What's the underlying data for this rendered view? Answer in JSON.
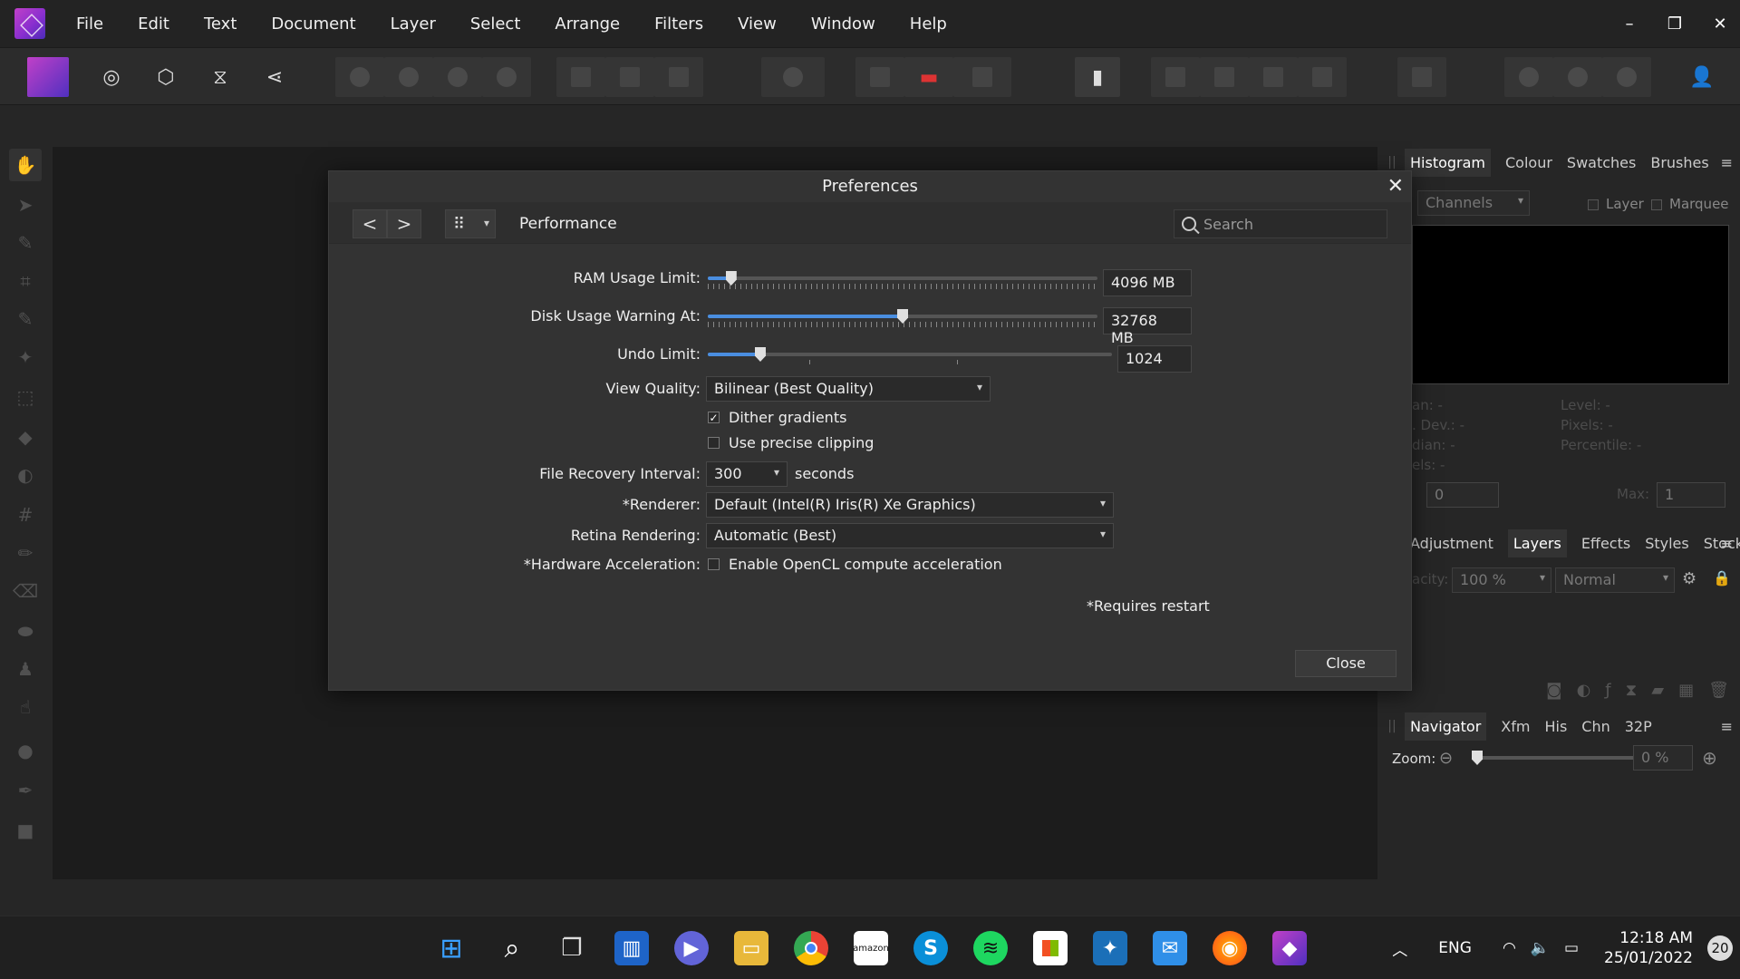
{
  "menubar": {
    "items": [
      "File",
      "Edit",
      "Text",
      "Document",
      "Layer",
      "Select",
      "Arrange",
      "Filters",
      "View",
      "Window",
      "Help"
    ],
    "window_controls": {
      "minimize": "–",
      "restore": "❐",
      "close": "✕"
    }
  },
  "studio": {
    "top_tabs": [
      "Histogram",
      "Colour",
      "Swatches",
      "Brushes"
    ],
    "channels_select": "Channels",
    "layer_check": "Layer",
    "marquee_check": "Marquee",
    "stats_left": [
      "an: -",
      ". Dev.: -",
      "dian: -",
      "els: -"
    ],
    "stats_right": [
      "Level: -",
      "Pixels: -",
      "Percentile: -"
    ],
    "min_value": "0",
    "max_label": "Max:",
    "max_value": "1",
    "mid_tabs": [
      "Adjustment",
      "Layers",
      "Effects",
      "Styles",
      "Stock"
    ],
    "opacity_label": "acity:",
    "opacity_value": "100 %",
    "blend_mode": "Normal",
    "bottom_tabs": [
      "Navigator",
      "Xfm",
      "His",
      "Chn",
      "32P"
    ],
    "zoom_label": "Zoom:",
    "zoom_value": "0 %",
    "panel_menu_glyph": "≡"
  },
  "prefs": {
    "title": "Preferences",
    "section": "Performance",
    "search_placeholder": "Search",
    "nav_back": "<",
    "nav_forward": ">",
    "ram": {
      "label": "RAM Usage Limit:",
      "value": "4096 MB",
      "fraction": 0.06
    },
    "disk": {
      "label": "Disk Usage Warning At:",
      "value": "32768 MB",
      "fraction": 0.5
    },
    "undo": {
      "label": "Undo Limit:",
      "value": "1024",
      "fraction": 0.13
    },
    "view_quality": {
      "label": "View Quality:",
      "value": "Bilinear (Best Quality)"
    },
    "dither": {
      "label": "Dither gradients",
      "checked": true
    },
    "precise_clipping": {
      "label": "Use precise clipping",
      "checked": false
    },
    "recovery": {
      "label": "File Recovery Interval:",
      "value": "300",
      "unit": "seconds"
    },
    "renderer": {
      "label": "*Renderer:",
      "value": "Default (Intel(R) Iris(R) Xe Graphics)"
    },
    "retina": {
      "label": "Retina Rendering:",
      "value": "Automatic (Best)"
    },
    "hw_accel": {
      "label": "*Hardware Acceleration:",
      "option": "Enable OpenCL compute acceleration",
      "checked": false
    },
    "requires_restart": "*Requires restart",
    "close_button": "Close"
  },
  "taskbar": {
    "lang": "ENG",
    "time": "12:18 AM",
    "date": "25/01/2022",
    "notifications": "20",
    "amazon_label": "amazon"
  }
}
